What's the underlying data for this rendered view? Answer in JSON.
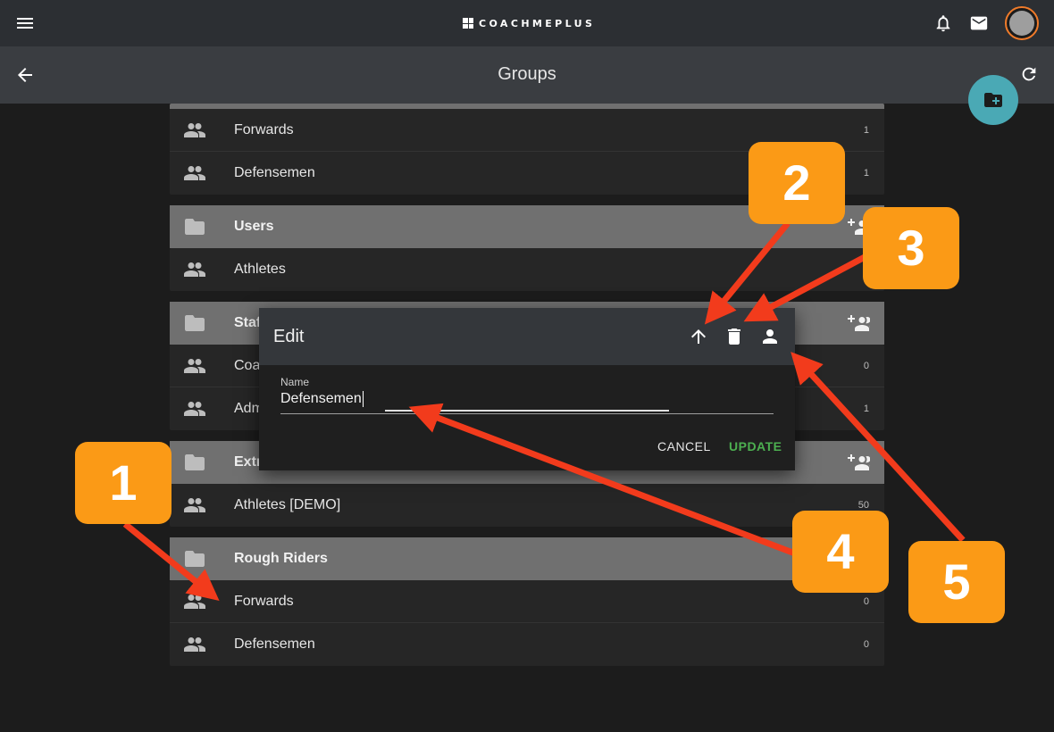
{
  "topbar": {
    "logo": "COACHMEPLUS"
  },
  "header": {
    "title": "Groups"
  },
  "groups": [
    {
      "type": "rows",
      "rows": [
        {
          "label": "Forwards",
          "count": "1"
        },
        {
          "label": "Defensemen",
          "count": "1"
        }
      ]
    },
    {
      "type": "header",
      "label": "Users"
    },
    {
      "type": "rows",
      "rows": [
        {
          "label": "Athletes",
          "count": ""
        }
      ]
    },
    {
      "type": "header",
      "label": "Staf"
    },
    {
      "type": "rows",
      "rows": [
        {
          "label": "Coa",
          "count": "0"
        },
        {
          "label": "Adm",
          "count": "1"
        }
      ]
    },
    {
      "type": "header",
      "label": "Extr"
    },
    {
      "type": "rows",
      "rows": [
        {
          "label": "Athletes [DEMO]",
          "count": "50"
        }
      ]
    },
    {
      "type": "header",
      "label": "Rough Riders"
    },
    {
      "type": "rows",
      "rows": [
        {
          "label": "Forwards",
          "count": "0"
        },
        {
          "label": "Defensemen",
          "count": "0"
        }
      ]
    }
  ],
  "dialog": {
    "title": "Edit",
    "field_label": "Name",
    "field_value": "Defensemen",
    "cancel_label": "CANCEL",
    "update_label": "UPDATE"
  },
  "callouts": [
    "1",
    "2",
    "3",
    "4",
    "5"
  ],
  "colors": {
    "accent": "#4aa9b5",
    "callout": "#fb9a16",
    "arrow": "#f23b1c",
    "update": "#4caf50",
    "avatar_ring": "#f07b2a"
  },
  "icons": [
    "menu-icon",
    "bell-icon",
    "mail-icon",
    "back-arrow-icon",
    "refresh-icon",
    "folder-add-icon",
    "group-icon",
    "folder-icon",
    "group-add-icon",
    "arrow-up-icon",
    "trash-icon",
    "person-icon"
  ]
}
